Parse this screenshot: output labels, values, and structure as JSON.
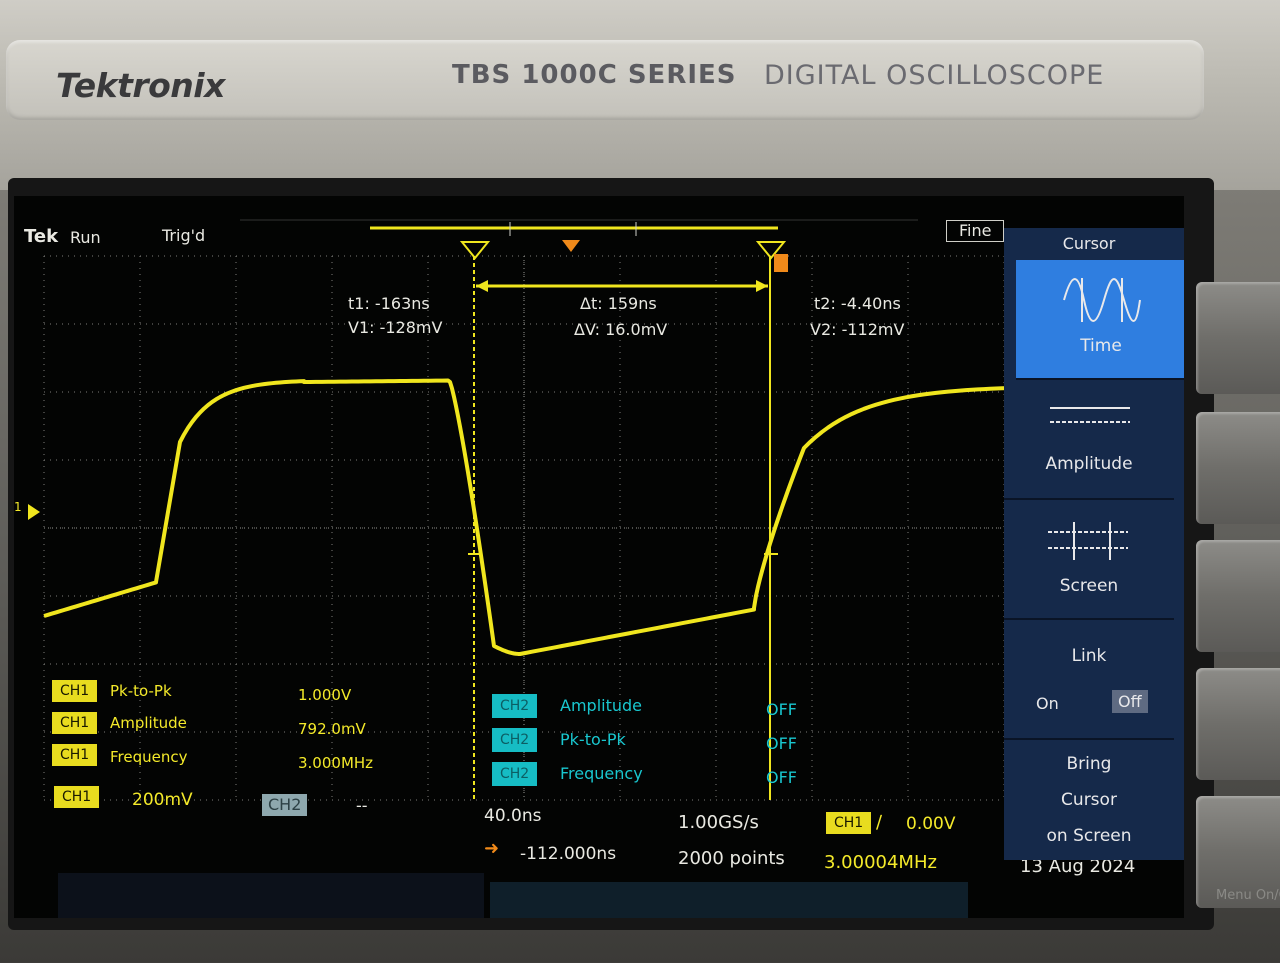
{
  "device": {
    "brand": "Tektronix",
    "series": "TBS 1000C SERIES",
    "type": "DIGITAL OSCILLOSCOPE"
  },
  "status": {
    "logo": "Tek",
    "run_state": "Run",
    "trigger_state": "Trig'd",
    "mode": "Fine"
  },
  "cursor_readout": {
    "t1": "t1: -163ns",
    "v1": "V1: -128mV",
    "dt": "Δt: 159ns",
    "dv": "ΔV: 16.0mV",
    "t2": "t2: -4.40ns",
    "v2": "V2: -112mV"
  },
  "measurements_ch1": [
    {
      "channel": "CH1",
      "name": "Pk-to-Pk",
      "value": "1.000V"
    },
    {
      "channel": "CH1",
      "name": "Amplitude",
      "value": "792.0mV"
    },
    {
      "channel": "CH1",
      "name": "Frequency",
      "value": "3.000MHz"
    }
  ],
  "measurements_ch2": [
    {
      "channel": "CH2",
      "name": "Amplitude",
      "value": "OFF"
    },
    {
      "channel": "CH2",
      "name": "Pk-to-Pk",
      "value": "OFF"
    },
    {
      "channel": "CH2",
      "name": "Frequency",
      "value": "OFF"
    }
  ],
  "bottom_bar": {
    "ch1_label": "CH1",
    "ch1_scale": "200mV",
    "ch2_label": "CH2",
    "ch2_scale": "--",
    "timebase": "40.0ns",
    "trigger_position": "-112.000ns",
    "sample_rate": "1.00GS/s",
    "record_length": "2000 points",
    "trigger_source": "CH1",
    "trigger_level": "0.00V",
    "trigger_frequency": "3.00004MHz",
    "date": "13 Aug 2024"
  },
  "side_menu": {
    "title": "Cursor",
    "time_label": "Time",
    "amplitude_label": "Amplitude",
    "screen_label": "Screen",
    "link_label": "Link",
    "link_on": "On",
    "link_off": "Off",
    "bring_1": "Bring",
    "bring_2": "Cursor",
    "bring_3": "on Screen",
    "selected": "Time",
    "link_selected": "Off"
  },
  "markers": {
    "channel_marker": "1",
    "cursor_a": "1",
    "cursor_b": "2",
    "trigger_marker": "T"
  },
  "colors": {
    "trace": "#f0e61e",
    "grid": "#7d7d78",
    "ch1": "#e8dc1f",
    "ch2_meas": "#19c7cf",
    "menu_bg": "#15294a",
    "menu_selected": "#2f7ee0"
  },
  "side_label": "Menu On/Off"
}
